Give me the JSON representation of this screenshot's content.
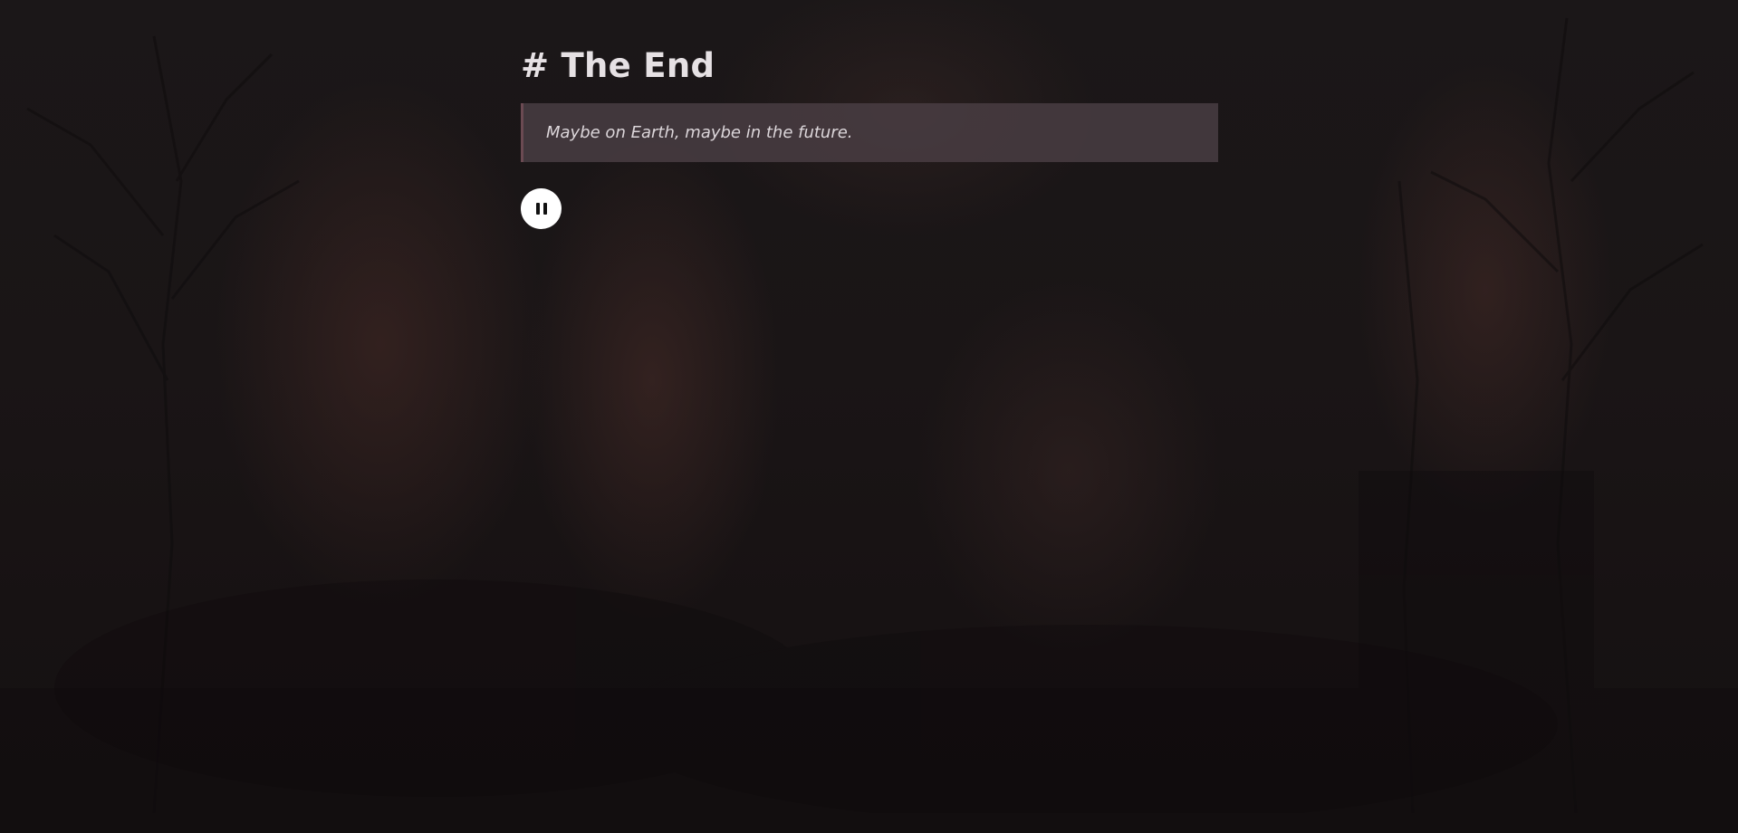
{
  "page": {
    "title": "# The End",
    "quote": "Maybe on Earth, maybe in the future."
  },
  "player": {
    "state": "playing",
    "button_icon": "pause-icon"
  },
  "colors": {
    "background": "#1a1516",
    "quote_background": "#4a3e44",
    "quote_border": "#6b4a52",
    "text": "#e6e1e4",
    "button": "#ffffff"
  }
}
